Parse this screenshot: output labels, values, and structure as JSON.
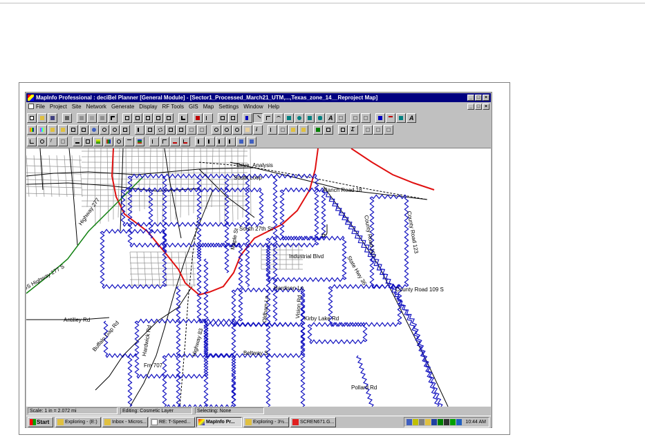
{
  "window": {
    "title": "MapInfo Professional : deciBel Planner [General Module] - [Sector1_Processed_March21_UTM,...,Texas_zone_14__Reproject Map]",
    "controls": [
      "_",
      "□",
      "×"
    ]
  },
  "menubar": {
    "items": [
      "File",
      "Project",
      "Site",
      "Network",
      "Generate",
      "Display",
      "RF Tools",
      "GIS",
      "Map",
      "Settings",
      "Window",
      "Help"
    ]
  },
  "map": {
    "labels": {
      "drive_analysis": "Drive_Analysis",
      "south_loop": "South Loop",
      "ranch_road": "Ranch Road 18",
      "south_27th": "South 27th St",
      "industrial": "Industrial Blvd",
      "hardison": "Hardison Ln",
      "county_road_109": "County Road 109 S",
      "county_road_107": "County Road 107",
      "county_road_123": "County Road 123",
      "kirby_lake": "Kirby Lake Rd",
      "antilley": "Antilley Rd",
      "beltway": "Beltway S",
      "pollard": "Pollard Rd",
      "fm_707": "Fm 707",
      "buffalo_gap": "Buffalo Gap Rd",
      "hardwick": "Hardwick Rd",
      "us_highway_277": "US Highway 277 S",
      "highway_277": "Highway 277",
      "maple": "Maple St",
      "oldham": "Oldham Ln",
      "vision": "Vision Rd",
      "highway_83": "Highway 83",
      "state_hwy": "State Hwy 36"
    },
    "colors": {
      "coverage": "#1010c0",
      "highway": "#e01010",
      "green_road": "#108010",
      "railroad": "#000000",
      "streets": "#909090"
    }
  },
  "statusbar": {
    "scale": "Scale: 1 in = 2.072 mi",
    "editing": "Editing: Cosmetic Layer",
    "selecting": "Selecting: None"
  },
  "taskbar": {
    "start": "Start",
    "buttons": [
      "Exploring - (E:)",
      "Inbox - Micros...",
      "RE: T-Speed...",
      "MapInfo Pr...",
      "Exploring - 3½...",
      "SCREN671.G..."
    ],
    "clock": "10:44 AM"
  }
}
